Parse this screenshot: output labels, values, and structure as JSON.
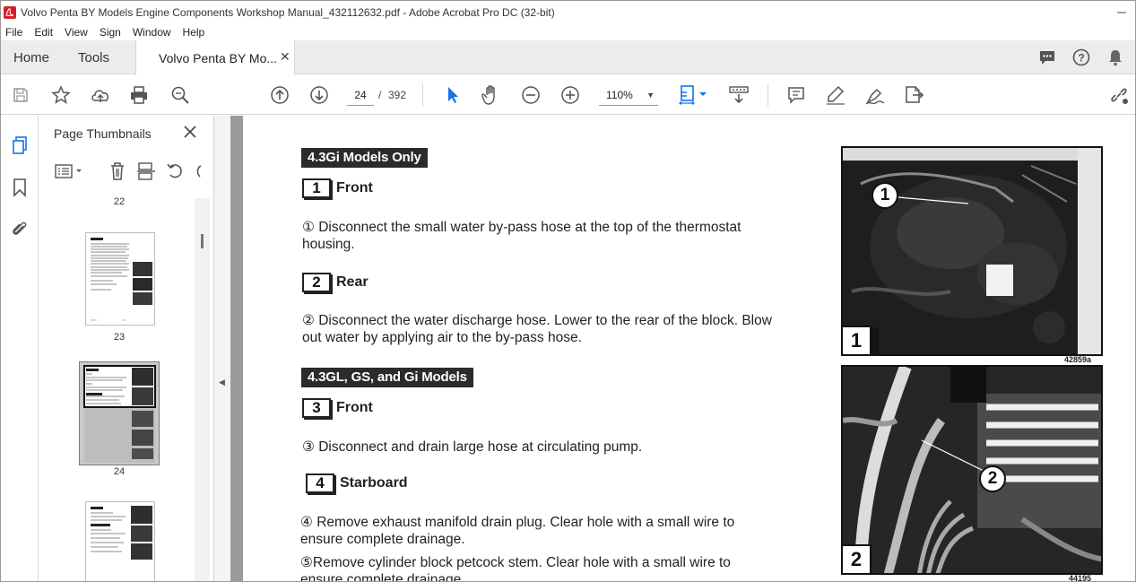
{
  "window": {
    "title": "Volvo Penta BY Models Engine Components Workshop Manual_432112632.pdf - Adobe Acrobat Pro DC (32-bit)"
  },
  "menu": [
    "File",
    "Edit",
    "View",
    "Sign",
    "Window",
    "Help"
  ],
  "tabs": {
    "home": "Home",
    "tools": "Tools",
    "document": "Volvo Penta BY Mo..."
  },
  "toolbar": {
    "current_page": "24",
    "page_separator": "/",
    "total_pages": "392",
    "zoom": "110%"
  },
  "thumbnails_panel": {
    "title": "Page Thumbnails",
    "pages": [
      "22",
      "23",
      "24",
      ""
    ],
    "current_page": "24"
  },
  "document": {
    "section1_title": "4.3Gi Models Only",
    "steps": [
      {
        "number": "1",
        "label": "Front"
      },
      {
        "number": "2",
        "label": "Rear"
      },
      {
        "number": "3",
        "label": "Front"
      },
      {
        "number": "4",
        "label": "Starboard"
      }
    ],
    "para1_line1": "① Disconnect the small water by-pass hose at the top of the thermostat",
    "para1_line2": "housing.",
    "para2_line1": "② Disconnect the water discharge hose. Lower to the rear of the block. Blow",
    "para2_line2": "out water by applying air to the by-pass hose.",
    "section2_title": "4.3GL, GS, and Gi Models",
    "para3": "③ Disconnect and drain large hose at circulating pump.",
    "para4_line1": "④ Remove exhaust manifold drain plug. Clear hole with a small wire to",
    "para4_line2": "ensure complete drainage.",
    "para5_line1": "⑤Remove cylinder block petcock stem. Clear hole with a small wire to",
    "para5_line2": "ensure complete drainage.",
    "photos": [
      {
        "number": "1",
        "callout": "1",
        "caption": "42859a"
      },
      {
        "number": "2",
        "callout": "2",
        "caption": "44195"
      }
    ]
  },
  "colors": {
    "acrobat_red": "#d4202a",
    "section_bar": "#2b2b2b",
    "doc_background": "#9b9b9b",
    "select_blue": "#1473e6"
  }
}
